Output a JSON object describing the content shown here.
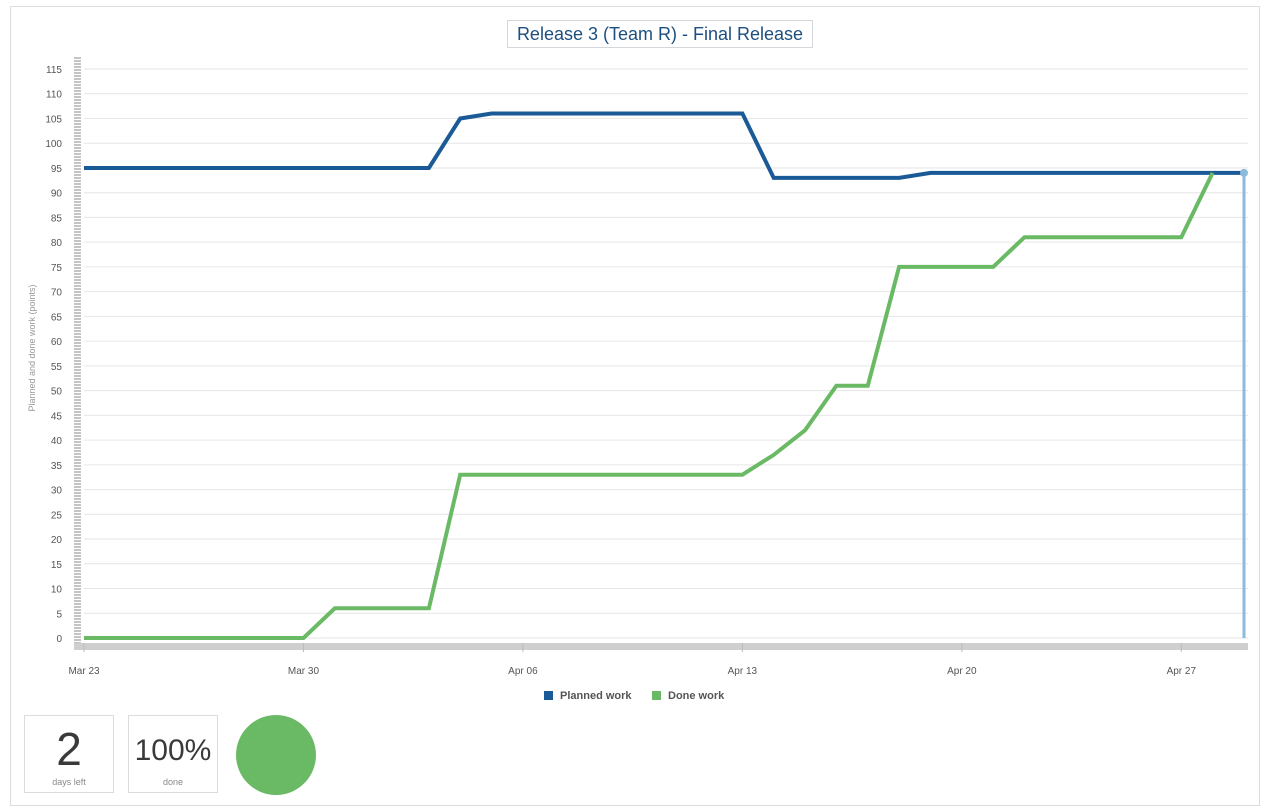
{
  "chart_data": {
    "type": "line",
    "title": "Release 3 (Team R) - Final Release",
    "xlabel": "",
    "ylabel": "Planned and done work (points)",
    "ylim": [
      0,
      115
    ],
    "y_ticks": [
      0,
      5,
      10,
      15,
      20,
      25,
      30,
      35,
      40,
      45,
      50,
      55,
      60,
      65,
      70,
      75,
      80,
      85,
      90,
      95,
      100,
      105,
      110,
      115
    ],
    "x_tick_labels": [
      "Mar 23",
      "Mar 30",
      "Apr 06",
      "Apr 13",
      "Apr 20",
      "Apr 27"
    ],
    "x_tick_dates": [
      "2020-03-23",
      "2020-03-30",
      "2020-04-06",
      "2020-04-13",
      "2020-04-20",
      "2020-04-27"
    ],
    "xlim": [
      "2020-03-23",
      "2020-04-29"
    ],
    "grid": true,
    "legend_position": "bottom-center",
    "series": [
      {
        "name": "Planned work",
        "color": "#1a5a96",
        "points": [
          [
            "2020-03-23",
            95
          ],
          [
            "2020-04-03",
            95
          ],
          [
            "2020-04-04",
            105
          ],
          [
            "2020-04-05",
            106
          ],
          [
            "2020-04-13",
            106
          ],
          [
            "2020-04-14",
            93
          ],
          [
            "2020-04-18",
            93
          ],
          [
            "2020-04-19",
            94
          ],
          [
            "2020-04-29",
            94
          ]
        ]
      },
      {
        "name": "Done work",
        "color": "#6ab964",
        "points": [
          [
            "2020-03-23",
            0
          ],
          [
            "2020-03-30",
            0
          ],
          [
            "2020-03-31",
            6
          ],
          [
            "2020-04-03",
            6
          ],
          [
            "2020-04-04",
            33
          ],
          [
            "2020-04-13",
            33
          ],
          [
            "2020-04-14",
            37
          ],
          [
            "2020-04-15",
            42
          ],
          [
            "2020-04-16",
            51
          ],
          [
            "2020-04-17",
            51
          ],
          [
            "2020-04-18",
            75
          ],
          [
            "2020-04-21",
            75
          ],
          [
            "2020-04-22",
            81
          ],
          [
            "2020-04-27",
            81
          ],
          [
            "2020-04-28",
            94
          ]
        ]
      }
    ],
    "marker": {
      "date": "2020-04-29",
      "value": 94,
      "color": "#8dbbdc"
    }
  },
  "stats": {
    "days_left_value": "2",
    "days_left_label": "days left",
    "done_value": "100%",
    "done_label": "done",
    "progress_fraction": 1.0,
    "progress_color": "#6ab964"
  }
}
